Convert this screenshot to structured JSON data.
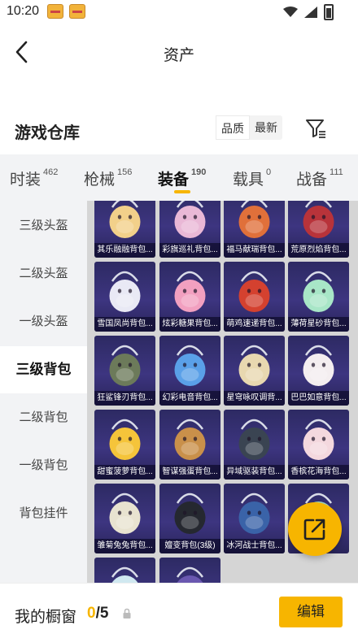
{
  "status_bar": {
    "time": "10:20",
    "app_icons": [
      "game-app-icon",
      "game-app-icon"
    ]
  },
  "header": {
    "title": "资产",
    "back_icon": "chevron-left-icon"
  },
  "warehouse": {
    "title": "游戏仓库",
    "sort_options": [
      {
        "label": "品质",
        "active": true
      },
      {
        "label": "最新",
        "active": false
      }
    ],
    "filter_icon": "filter-icon"
  },
  "tabs": [
    {
      "label": "时装",
      "count": "462",
      "active": false
    },
    {
      "label": "枪械",
      "count": "156",
      "active": false
    },
    {
      "label": "装备",
      "count": "190",
      "active": true
    },
    {
      "label": "载具",
      "count": "0",
      "active": false
    },
    {
      "label": "战备",
      "count": "111",
      "active": false
    }
  ],
  "sidebar": [
    {
      "label": "三级头盔",
      "active": false
    },
    {
      "label": "二级头盔",
      "active": false
    },
    {
      "label": "一级头盔",
      "active": false
    },
    {
      "label": "三级背包",
      "active": true
    },
    {
      "label": "二级背包",
      "active": false
    },
    {
      "label": "一级背包",
      "active": false
    },
    {
      "label": "背包挂件",
      "active": false
    }
  ],
  "items": [
    {
      "name": "其乐融融背包...",
      "color": "#f2d08a"
    },
    {
      "name": "彩旗巡礼背包...",
      "color": "#e9b8d6"
    },
    {
      "name": "福马献瑞背包...",
      "color": "#e0703a"
    },
    {
      "name": "荒原烈焰背包...",
      "color": "#b8333a"
    },
    {
      "name": "雪国凤尚背包...",
      "color": "#e9e9f5"
    },
    {
      "name": "炫彩糖果背包...",
      "color": "#f2a0c0"
    },
    {
      "name": "萌鸡速递背包...",
      "color": "#d4412f"
    },
    {
      "name": "薄荷星砂背包...",
      "color": "#a8e6c7"
    },
    {
      "name": "狂鲨锋刃背包...",
      "color": "#6c7a5a"
    },
    {
      "name": "幻彩电音背包...",
      "color": "#5aa0e8"
    },
    {
      "name": "星穹咏叹调背...",
      "color": "#e8d8b0"
    },
    {
      "name": "巴巴如意背包...",
      "color": "#f4eef0"
    },
    {
      "name": "甜蜜菠萝背包...",
      "color": "#f5c43a"
    },
    {
      "name": "智谋强蛋背包...",
      "color": "#c9904a"
    },
    {
      "name": "异域驱装背包...",
      "color": "#3a4452"
    },
    {
      "name": "香槟花海背包...",
      "color": "#f4d8de"
    },
    {
      "name": "雏菊兔兔背包...",
      "color": "#e8e3d0"
    },
    {
      "name": "嬗变背包(3级)",
      "color": "#252830"
    },
    {
      "name": "冰河战士背包...",
      "color": "#3a63a8"
    },
    {
      "name": "",
      "color": "#9ed6c2"
    },
    {
      "name": "",
      "color": "#d0e8f0"
    },
    {
      "name": "",
      "color": "#6a58b0"
    }
  ],
  "bottom_bar": {
    "label": "我的橱窗",
    "current": "0",
    "total": "/5",
    "edit_label": "编辑"
  },
  "colors": {
    "accent": "#f7b500",
    "card_bg": "#2d2a63",
    "tab_bg": "#f2f3f5"
  }
}
